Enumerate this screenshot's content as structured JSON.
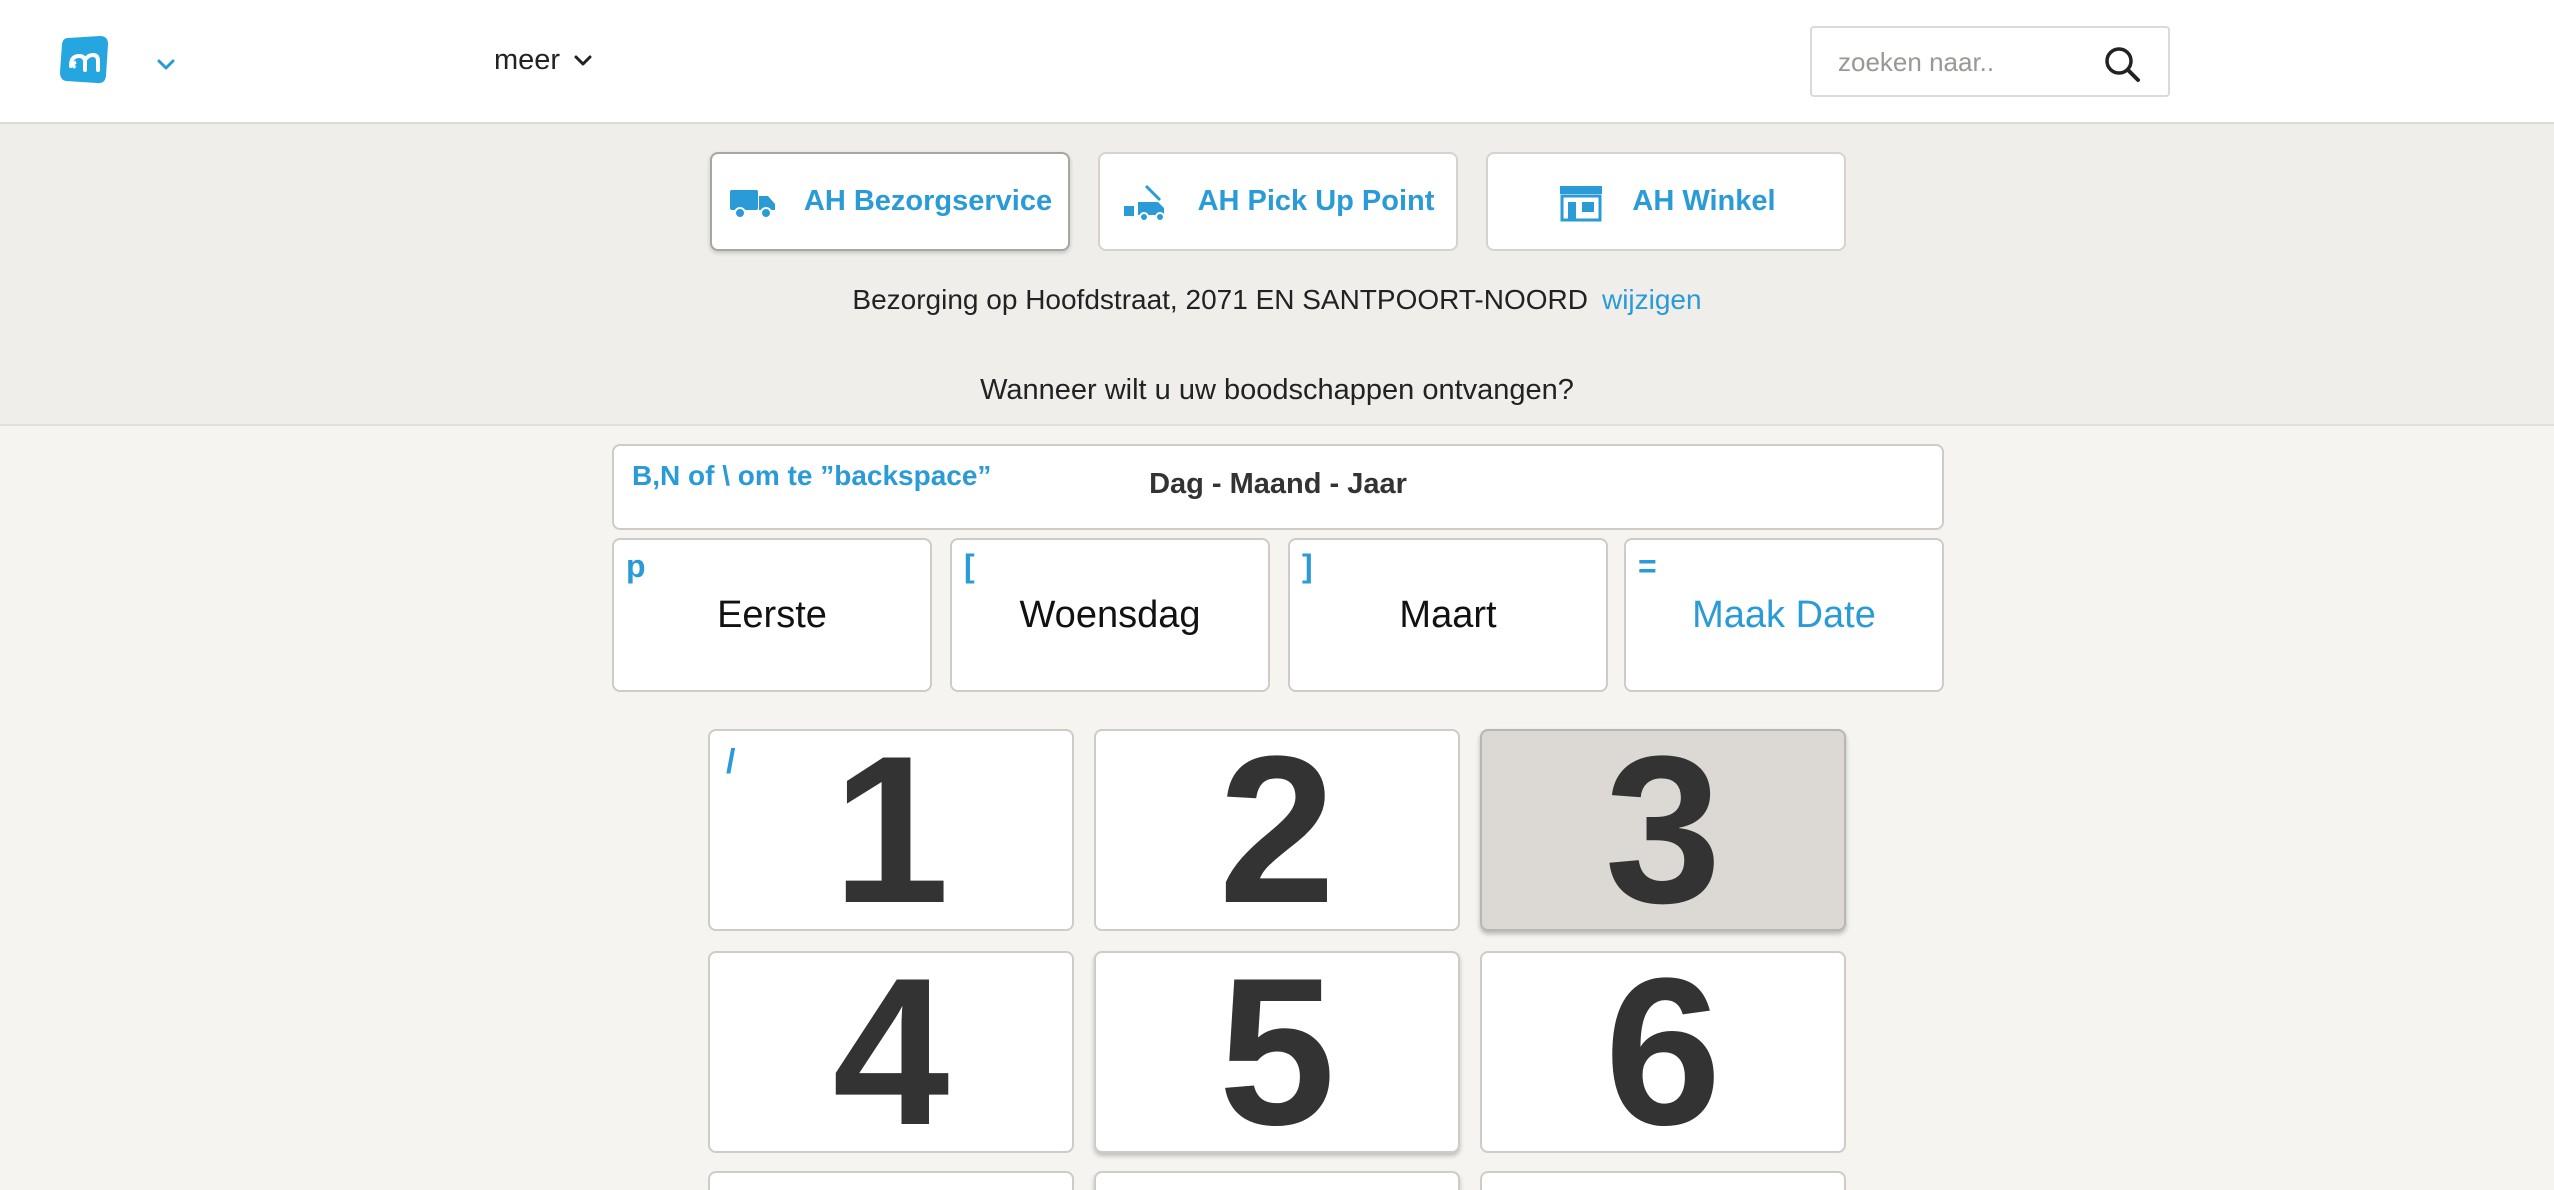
{
  "header": {
    "more_label": "meer",
    "search_placeholder": "zoeken naar.."
  },
  "modes": [
    {
      "label": "AH Bezorgservice",
      "icon": "delivery-truck-icon",
      "active": true
    },
    {
      "label": "AH Pick Up Point",
      "icon": "pickup-point-icon",
      "active": false
    },
    {
      "label": "AH Winkel",
      "icon": "store-icon",
      "active": false
    }
  ],
  "delivery": {
    "text": "Bezorging op Hoofdstraat, 2071 EN SANTPOORT-NOORD",
    "change_label": "wijzigen"
  },
  "question": "Wanneer wilt u uw boodschappen ontvangen?",
  "date_display": {
    "hint": "B,N of \\ om te ”backspace”",
    "format": "Dag - Maand - Jaar"
  },
  "options": [
    {
      "key": "p",
      "label": "Eerste"
    },
    {
      "key": "[",
      "label": "Woensdag"
    },
    {
      "key": "]",
      "label": "Maart"
    },
    {
      "key": "=",
      "label": "Maak Date"
    }
  ],
  "keypad": {
    "key_hint": "/",
    "digits": [
      "1",
      "2",
      "3",
      "4",
      "5",
      "6"
    ]
  },
  "colors": {
    "accent": "#2a9bd6",
    "background": "#f5f4f1",
    "strip": "#efeeeb",
    "pressed": "#dcd9d4"
  }
}
